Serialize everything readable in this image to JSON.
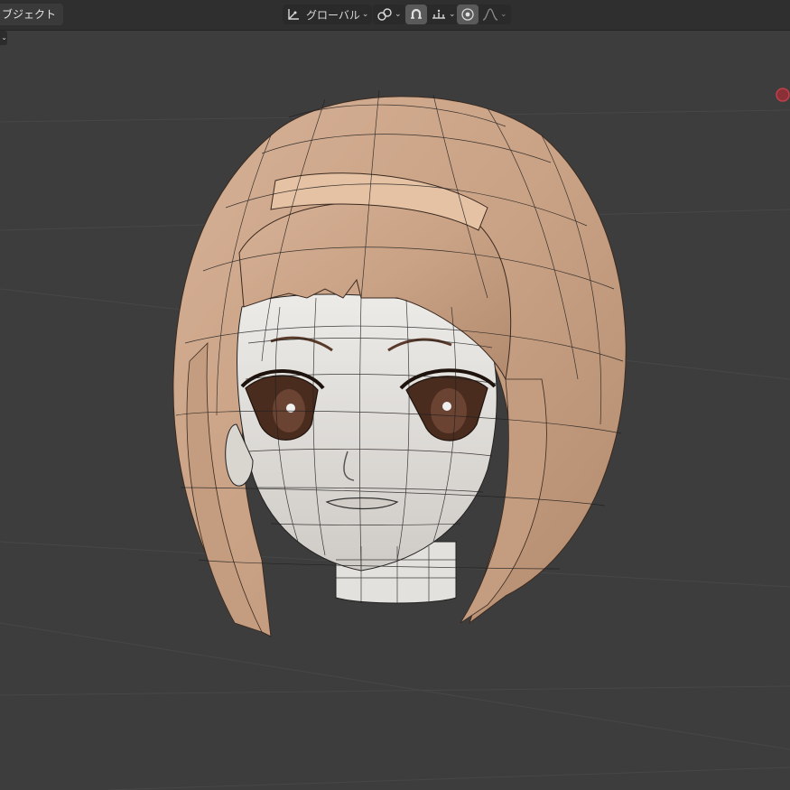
{
  "header": {
    "mode_label": "ブジェクト",
    "orientation_label": "グローバル",
    "icons": {
      "transform_orientation": "transform-orientation-icon",
      "pivot": "pivot-link-icon",
      "snap": "snap-magnet-icon",
      "snap_target": "snap-increment-icon",
      "proportional": "proportional-edit-icon",
      "falloff": "falloff-curve-icon"
    },
    "chevron": "⌄"
  },
  "viewport": {
    "background": "#3d3d3d",
    "grid_color": "#474747",
    "object": "anime-girl-head-mesh",
    "hair_color": "#c9a184",
    "skin_color": "#dcd8d2",
    "eye_color": "#4a2c1f",
    "light_gizmo_color": "#c0404a"
  }
}
